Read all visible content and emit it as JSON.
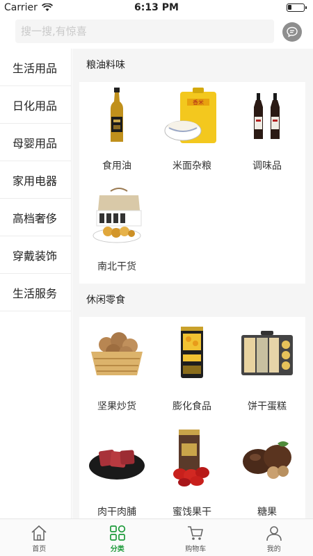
{
  "status_bar": {
    "carrier": "Carrier",
    "time": "6:13 PM"
  },
  "search": {
    "placeholder": "搜一搜,有惊喜"
  },
  "sidebar": {
    "items": [
      {
        "label": "生活用品"
      },
      {
        "label": "日化用品"
      },
      {
        "label": "母婴用品"
      },
      {
        "label": "家用电器"
      },
      {
        "label": "高档奢侈"
      },
      {
        "label": "穿戴装饰"
      },
      {
        "label": "生活服务"
      }
    ]
  },
  "sections": [
    {
      "title": "粮油料味",
      "items": [
        {
          "label": "食用油",
          "icon": "cooking-oil-bottle-image"
        },
        {
          "label": "米面杂粮",
          "icon": "rice-bag-image"
        },
        {
          "label": "调味品",
          "icon": "soy-sauce-bottles-image"
        },
        {
          "label": "南北干货",
          "icon": "dried-goods-giftbox-image"
        }
      ]
    },
    {
      "title": "休闲零食",
      "items": [
        {
          "label": "坚果炒货",
          "icon": "walnut-basket-image"
        },
        {
          "label": "膨化食品",
          "icon": "snack-canister-image"
        },
        {
          "label": "饼干蛋糕",
          "icon": "biscuit-box-image"
        },
        {
          "label": "肉干肉脯",
          "icon": "beef-jerky-plate-image"
        },
        {
          "label": "蜜饯果干",
          "icon": "jujube-jar-image"
        },
        {
          "label": "糖果",
          "icon": "chocolate-candy-image"
        }
      ]
    }
  ],
  "tabbar": {
    "tabs": [
      {
        "label": "首页",
        "icon": "home-icon"
      },
      {
        "label": "分类",
        "icon": "category-grid-icon",
        "active": true
      },
      {
        "label": "购物车",
        "icon": "cart-icon"
      },
      {
        "label": "我的",
        "icon": "user-icon"
      }
    ]
  },
  "colors": {
    "accent": "#1d9a3a",
    "page_bg": "#f5f5f5",
    "message_button": "#8e8e8e"
  }
}
